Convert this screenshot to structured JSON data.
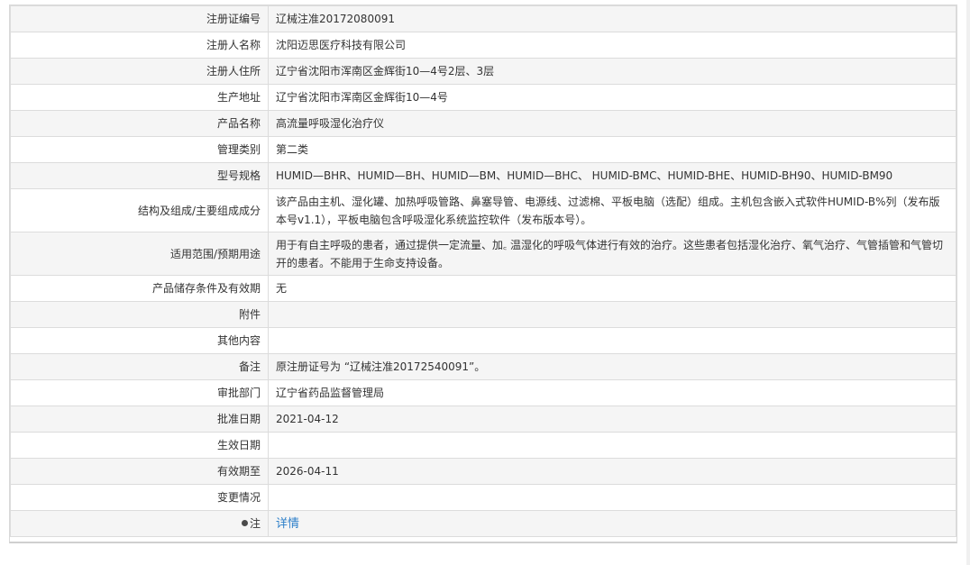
{
  "rows": [
    {
      "label": "注册证编号",
      "value": "辽械注准20172080091"
    },
    {
      "label": "注册人名称",
      "value": "沈阳迈思医疗科技有限公司"
    },
    {
      "label": "注册人住所",
      "value": "辽宁省沈阳市浑南区金辉街10—4号2层、3层"
    },
    {
      "label": "生产地址",
      "value": "辽宁省沈阳市浑南区金辉街10—4号"
    },
    {
      "label": "产品名称",
      "value": "高流量呼吸湿化治疗仪"
    },
    {
      "label": "管理类别",
      "value": "第二类"
    },
    {
      "label": "型号规格",
      "value": "HUMID—BHR、HUMID—BH、HUMID—BM、HUMID—BHC、 HUMID-BMC、HUMID-BHE、HUMID-BH90、HUMID-BM90"
    },
    {
      "label": "结构及组成/主要组成成分",
      "value": "该产品由主机、湿化罐、加热呼吸管路、鼻塞导管、电源线、过滤棉、平板电脑（选配）组成。主机包含嵌入式软件HUMID-B%列（发布版本号v1.1），平板电脑包含呼吸湿化系统监控软件（发布版本号）。"
    },
    {
      "label": "适用范围/预期用途",
      "value": "用于有自主呼吸的患者，通过提供一定流量、加꜀ 温湿化的呼吸气体进行有效的治疗。这些患者包括湿化治疗、氧气治疗、气管插管和气管切开的患者。不能用于生命支持设备。"
    },
    {
      "label": "产品储存条件及有效期",
      "value": "无"
    },
    {
      "label": "附件",
      "value": ""
    },
    {
      "label": "其他内容",
      "value": ""
    },
    {
      "label": "备注",
      "value": "原注册证号为 “辽械注准20172540091”。"
    },
    {
      "label": "审批部门",
      "value": "辽宁省药品监督管理局"
    },
    {
      "label": "批准日期",
      "value": "2021-04-12"
    },
    {
      "label": "生效日期",
      "value": ""
    },
    {
      "label": "有效期至",
      "value": "2026-04-11"
    },
    {
      "label": "变更情况",
      "value": ""
    }
  ],
  "note_row": {
    "label": "注",
    "link_text": "详情",
    "icon": "bullet-icon"
  }
}
